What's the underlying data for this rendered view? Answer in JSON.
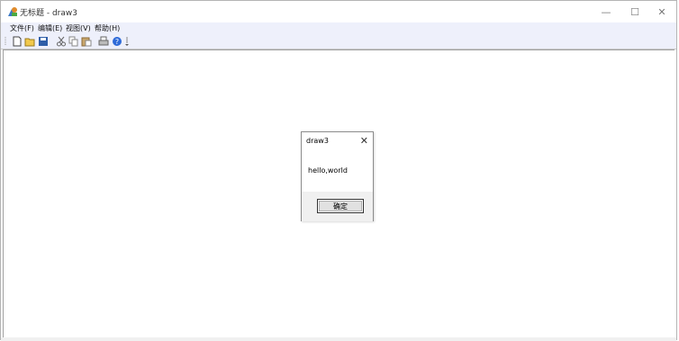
{
  "window": {
    "title": "无标题 - draw3",
    "controls": {
      "minimize": "—",
      "maximize": "☐",
      "close": "✕"
    }
  },
  "menubar": {
    "items": [
      {
        "label": "文件(F)"
      },
      {
        "label": "编辑(E)"
      },
      {
        "label": "视图(V)"
      },
      {
        "label": "帮助(H)"
      }
    ]
  },
  "toolbar": {
    "buttons": [
      "new-icon",
      "open-icon",
      "save-icon",
      "cut-icon",
      "copy-icon",
      "paste-icon",
      "print-icon",
      "help-icon"
    ]
  },
  "dialog": {
    "title": "draw3",
    "close_symbol": "✕",
    "message": "hello,world",
    "ok_label": "确定"
  }
}
